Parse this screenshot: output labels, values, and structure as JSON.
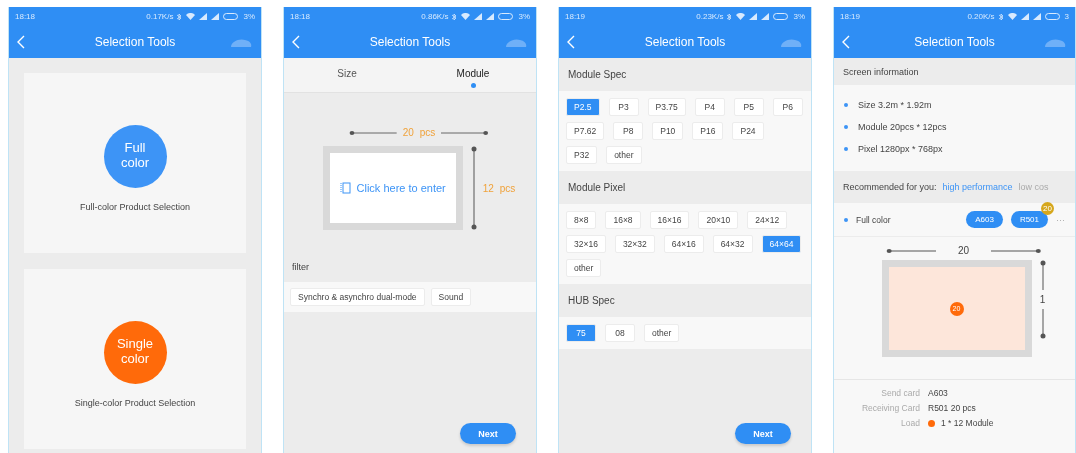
{
  "screens": [
    {
      "kind": "product",
      "status": {
        "time": "18:18",
        "speed": "0.17K/s",
        "battery": "3%"
      },
      "title": "Selection Tools",
      "cards": [
        {
          "circle": "Full color",
          "caption": "Full-color Product Selection",
          "color": "#3d94f6"
        },
        {
          "circle": "Single color",
          "caption": "Single-color Product Selection",
          "color": "#ff6a0a"
        }
      ]
    },
    {
      "kind": "size",
      "status": {
        "time": "18:18",
        "speed": "0.86K/s",
        "battery": "3%"
      },
      "title": "Selection Tools",
      "tabs": [
        {
          "label": "Size",
          "selected": false
        },
        {
          "label": "Module",
          "selected": true
        }
      ],
      "width": {
        "value": "20",
        "unit": "pcs"
      },
      "height": {
        "value": "12",
        "unit": "pcs"
      },
      "enter": "Click here to enter",
      "filter_title": "filter",
      "filters": [
        "Synchro & asynchro dual-mode",
        "Sound"
      ],
      "next": "Next"
    },
    {
      "kind": "spec",
      "status": {
        "time": "18:19",
        "speed": "0.23K/s",
        "battery": "3%"
      },
      "title": "Selection Tools",
      "sections": [
        {
          "title": "Module Spec",
          "options": [
            {
              "label": "P2.5",
              "selected": true
            },
            {
              "label": "P3",
              "selected": false
            },
            {
              "label": "P3.75",
              "selected": false
            },
            {
              "label": "P4",
              "selected": false
            },
            {
              "label": "P5",
              "selected": false
            },
            {
              "label": "P6",
              "selected": false
            },
            {
              "label": "P7.62",
              "selected": false
            },
            {
              "label": "P8",
              "selected": false
            },
            {
              "label": "P10",
              "selected": false
            },
            {
              "label": "P16",
              "selected": false
            },
            {
              "label": "P24",
              "selected": false
            },
            {
              "label": "P32",
              "selected": false
            },
            {
              "label": "other",
              "selected": false
            }
          ]
        },
        {
          "title": "Module Pixel",
          "options": [
            {
              "label": "8×8",
              "selected": false
            },
            {
              "label": "16×8",
              "selected": false
            },
            {
              "label": "16×16",
              "selected": false
            },
            {
              "label": "20×10",
              "selected": false
            },
            {
              "label": "24×12",
              "selected": false
            },
            {
              "label": "32×16",
              "selected": false
            },
            {
              "label": "32×32",
              "selected": false
            },
            {
              "label": "64×16",
              "selected": false
            },
            {
              "label": "64×32",
              "selected": false
            },
            {
              "label": "64×64",
              "selected": true
            },
            {
              "label": "other",
              "selected": false
            }
          ]
        },
        {
          "title": "HUB Spec",
          "options": [
            {
              "label": "75",
              "selected": true
            },
            {
              "label": "08",
              "selected": false
            },
            {
              "label": "other",
              "selected": false
            }
          ]
        }
      ],
      "next": "Next"
    },
    {
      "kind": "info",
      "status": {
        "time": "18:19",
        "speed": "0.20K/s",
        "battery": "3"
      },
      "title": "Selection Tools",
      "info_title": "Screen information",
      "info_items": [
        "Size 3.2m * 1.92m",
        "Module 20pcs * 12pcs",
        "Pixel 1280px * 768px"
      ],
      "recommend_label": "Recommended for you:",
      "recommend_options": [
        {
          "label": "high performance",
          "selected": true
        },
        {
          "label": "low cos",
          "selected": false
        }
      ],
      "product": {
        "name": "Full color",
        "chips": [
          {
            "label": "A603"
          },
          {
            "label": "R501",
            "badge": "20"
          }
        ],
        "more": "···"
      },
      "width_value": "20",
      "height_value": "1",
      "center_badge": "20",
      "details": [
        {
          "label": "Send card",
          "value": "A603",
          "dot": false
        },
        {
          "label": "Receiving Card",
          "value": "R501 20 pcs",
          "dot": false
        },
        {
          "label": "Load",
          "value": "1 * 12 Module",
          "dot": true
        }
      ]
    }
  ]
}
